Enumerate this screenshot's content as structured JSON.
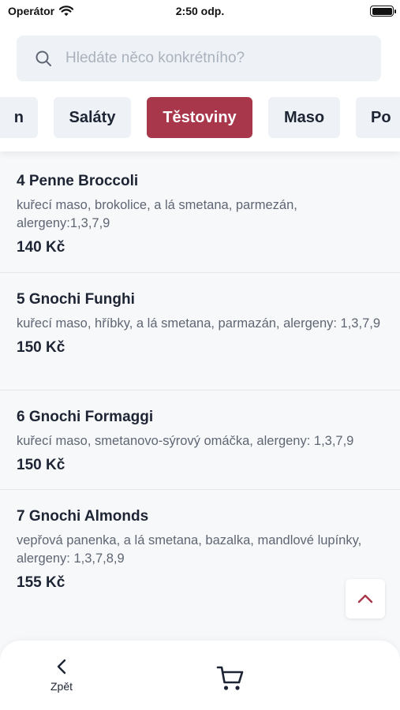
{
  "status_bar": {
    "carrier": "Operátor",
    "time": "2:50 odp."
  },
  "search": {
    "placeholder": "Hledáte něco konkrétního?",
    "icon": "search-icon"
  },
  "categories": [
    {
      "label": "n",
      "active": false
    },
    {
      "label": "Saláty",
      "active": false
    },
    {
      "label": "Těstoviny",
      "active": true
    },
    {
      "label": "Maso",
      "active": false
    },
    {
      "label": "Po",
      "active": false
    }
  ],
  "menu_items": [
    {
      "title": "4 Penne Broccoli",
      "description": "kuřecí maso, brokolice, a lá smetana, parmezán, alergeny:1,3,7,9",
      "price": "140 Kč"
    },
    {
      "title": "5 Gnochi Funghi",
      "description": "kuřecí maso, hříbky, a lá smetana, parmazán, alergeny: 1,3,7,9",
      "price": "150 Kč"
    },
    {
      "title": "6 Gnochi Formaggi",
      "description": "kuřecí maso, smetanovo-sýrový omáčka, alergeny: 1,3,7,9",
      "price": "150 Kč"
    },
    {
      "title": "7 Gnochi Almonds",
      "description": "vepřová panenka, a lá smetana, bazalka, mandlové lupínky, alergeny: 1,3,7,8,9",
      "price": "155 Kč"
    }
  ],
  "bottom_bar": {
    "back_label": "Zpět",
    "back_icon": "chevron-left-icon",
    "cart_icon": "cart-icon"
  },
  "scroll_top_icon": "chevron-up-icon",
  "colors": {
    "accent": "#a8374b",
    "chip_bg": "#eef1f5",
    "text": "#1d2433",
    "muted": "#5f6673"
  }
}
